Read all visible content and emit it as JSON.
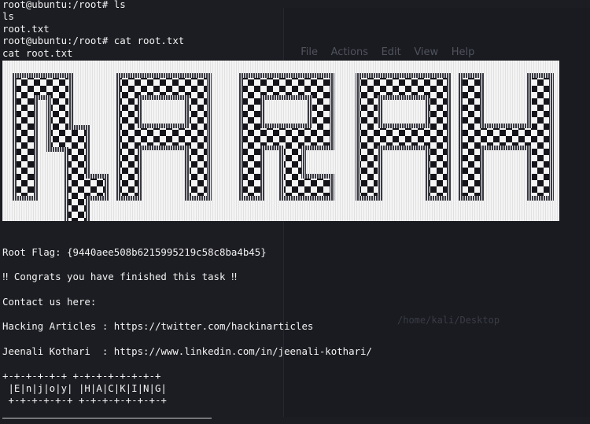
{
  "background_window": {
    "menu": [
      "File",
      "Actions",
      "Edit",
      "View",
      "Help"
    ],
    "path": "/home/kali/Desktop"
  },
  "terminal": {
    "prompt1": "root@ubuntu:/root# ls",
    "echo1": "ls",
    "out1": "root.txt",
    "prompt2": "root@ubuntu:/root# cat root.txt",
    "echo2": "cat root.txt",
    "banner_text": "NARAK",
    "root_flag": "Root Flag: {9440aee508b6215995219c58c8ba4b45}",
    "congrats": "‼ Congrats you have finished this task ‼",
    "contact": "Contact us here:",
    "hacking_articles": "Hacking Articles : https://twitter.com/hackinarticles",
    "jeenali": "Jeenali Kothari  : https://www.linkedin.com/in/jeenali-kothari/",
    "box_top": "+-+-+-+-+-+ +-+-+-+-+-+-+-+",
    "box_mid": " |E|n|j|o|y| |H|A|C|K|I|N|G|",
    "box_bot": " +-+-+-+-+-+ +-+-+-+-+-+-+-+"
  },
  "colors": {
    "background": "#1c1d22",
    "text": "#f2f2f2",
    "banner_bg": "#f4f4f4",
    "banner_ink": "#14141a"
  }
}
